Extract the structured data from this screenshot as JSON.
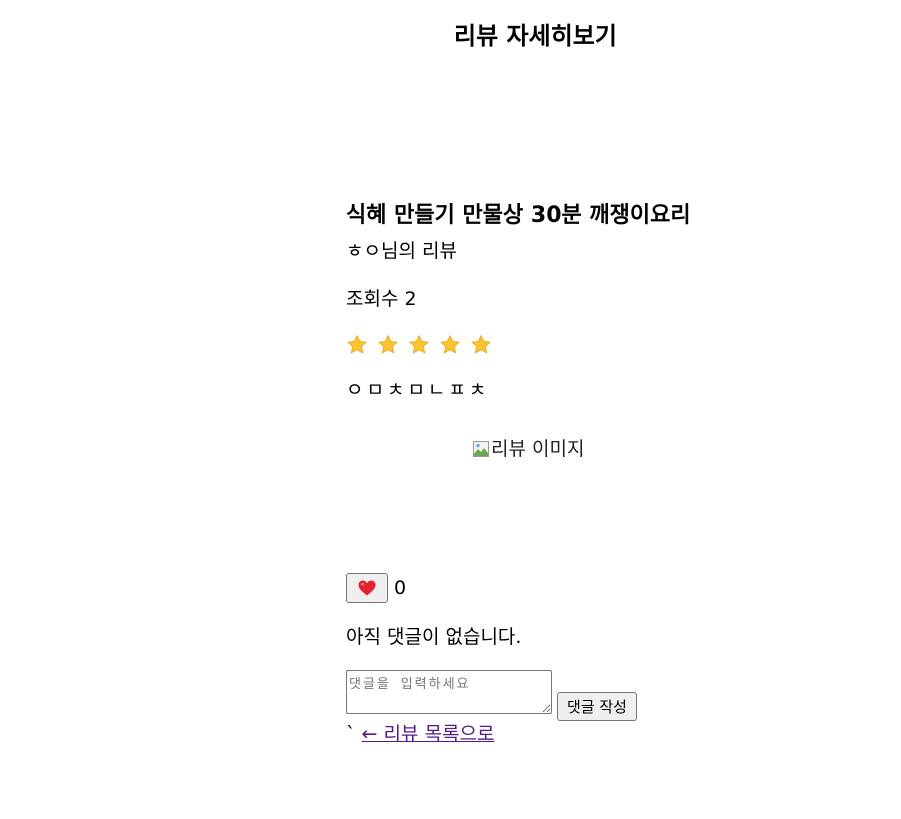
{
  "header": {
    "title": "리뷰 자세히보기"
  },
  "review": {
    "recipe_title": "식혜 만들기 만물상 30분 깨쟁이요리",
    "author_line": "ㅎㅇ님의 리뷰",
    "views_line": "조회수 2",
    "rating": 5,
    "rating_max": 5,
    "star_color": "#FFC42E",
    "body": "ㅇㅁㅊㅁㄴㅍㅊ",
    "image_alt": "리뷰 이미지"
  },
  "likes": {
    "icon": "heart-icon",
    "count": "0"
  },
  "comments": {
    "empty_message": "아직 댓글이 없습니다.",
    "input_placeholder": "댓글을 입력하세요",
    "submit_label": "댓글 작성"
  },
  "footer": {
    "stray_char": "`",
    "back_link": "← 리뷰 목록으로"
  }
}
